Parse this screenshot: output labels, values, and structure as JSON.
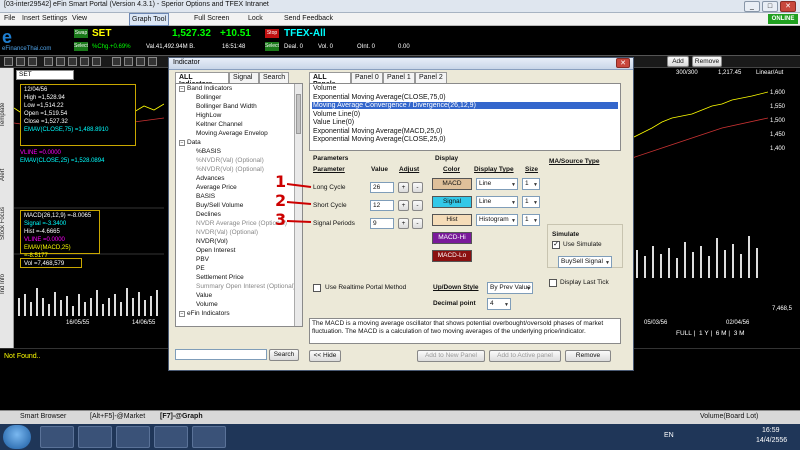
{
  "window": {
    "title": "[03-inter29542] eFin Smart Portal (Version 4.3.1) - Sperior Options and TFEX Intranet",
    "status": "ONLINE"
  },
  "menu": {
    "file": "File",
    "insert": "Insert",
    "settings": "Settings",
    "view": "View",
    "graph_tool": "Graph Tool",
    "full_screen": "Full Screen",
    "lock": "Lock",
    "send_feedback": "Send Feedback"
  },
  "ticker": {
    "logo": "eFinanceThai.com",
    "set_tag": "Swap",
    "set_name": "SET",
    "set_value": "1,527.32",
    "set_change": "+10.51",
    "select_tag": "Select",
    "chg": "%Chg.+0.69%",
    "val": "Val.41,492.94M B.",
    "time": "16:51:48",
    "stop_tag": "Stop",
    "tfex_name": "TFEX-All",
    "tfex_select": "Select",
    "deal": "Deal. 0",
    "vol": "Vol. 0",
    "oint": "OInt. 0",
    "ind": "0.00"
  },
  "chart": {
    "symbol": "SET",
    "add": "Add",
    "remove": "Remove",
    "info": {
      "date": "12/04/56",
      "high": "High =1,528.94",
      "low": "Low =1,514.22",
      "open": "Open =1,519.54",
      "close": "Close =1,527.32",
      "emav_close75": "EMAV(CLOSE,75) =1,488.8910",
      "vline": "VLINE =0.0000",
      "emav_close25": "EMAV(CLOSE,25) =1,528.0894"
    },
    "macd": {
      "title": "MACD(26,12,9) =-8.0065",
      "signal": "Signal =-3.3400",
      "hist": "Hist =-4.6665",
      "vline": "VLINE =0.0000",
      "emav": "EMAV(MACD,25) =-8.5177"
    },
    "vol": "Vol =7,468,579",
    "dates": [
      "16/05/55",
      "14/06/55",
      "05/03/56",
      "02/04/56"
    ],
    "right_top": "300/300",
    "right_val": "1,217.45",
    "right_scale": "Linear/Aut",
    "right_prices": [
      "1,600",
      "1,550",
      "1,500",
      "1,450",
      "1,400"
    ],
    "periods": [
      "FULL",
      "1 Y",
      "6 M",
      "3 M"
    ],
    "right_vol": "7,468,5"
  },
  "rail": {
    "template": "Template",
    "alert": "Alert",
    "stock_focus": "Stock Focus",
    "ind_info": "Ind Info"
  },
  "notfound": "Not Found..",
  "status": {
    "smart_browser": "Smart Browser",
    "market": "[Alt+F5]-@Market",
    "graph": "[F7]-@Graph",
    "volume": "Volume(Board Lot)"
  },
  "taskbar": {
    "lang": "EN",
    "time": "16:59",
    "date": "14/4/2556"
  },
  "dialog": {
    "title": "Indicator",
    "left_tabs": [
      "ALL Indicators",
      "Signal",
      "Search"
    ],
    "tree": [
      {
        "label": "Band Indicators",
        "group": true,
        "dim": false
      },
      {
        "label": "Bollinger",
        "group": false,
        "dim": false
      },
      {
        "label": "Bollinger Band Width",
        "group": false,
        "dim": false
      },
      {
        "label": "HighLow",
        "group": false,
        "dim": false
      },
      {
        "label": "Keltner Channel",
        "group": false,
        "dim": false
      },
      {
        "label": "Moving Average Envelop",
        "group": false,
        "dim": false
      },
      {
        "label": "Data",
        "group": true,
        "dim": false
      },
      {
        "label": "%BASIS",
        "group": false,
        "dim": false
      },
      {
        "label": "%NVDR(Val) (Optional)",
        "group": false,
        "dim": true
      },
      {
        "label": "%NVDR(Vol) (Optional)",
        "group": false,
        "dim": true
      },
      {
        "label": "Advances",
        "group": false,
        "dim": false
      },
      {
        "label": "Average Price",
        "group": false,
        "dim": false
      },
      {
        "label": "BASIS",
        "group": false,
        "dim": false
      },
      {
        "label": "Buy/Sell Volume",
        "group": false,
        "dim": false
      },
      {
        "label": "Declines",
        "group": false,
        "dim": false
      },
      {
        "label": "NVDR Average Price (Optional)",
        "group": false,
        "dim": true
      },
      {
        "label": "NVDR(Val) (Optional)",
        "group": false,
        "dim": true
      },
      {
        "label": "NVDR(Vol)",
        "group": false,
        "dim": false
      },
      {
        "label": "Open Interest",
        "group": false,
        "dim": false
      },
      {
        "label": "PBV",
        "group": false,
        "dim": false
      },
      {
        "label": "PE",
        "group": false,
        "dim": false
      },
      {
        "label": "Settlement Price",
        "group": false,
        "dim": false
      },
      {
        "label": "Summary Open Interest (Optional)",
        "group": false,
        "dim": true
      },
      {
        "label": "Value",
        "group": false,
        "dim": false
      },
      {
        "label": "Volume",
        "group": false,
        "dim": false
      },
      {
        "label": "eFin Indicators",
        "group": true,
        "dim": false
      }
    ],
    "search_button": "Search",
    "hide_button": "<< Hide",
    "right_tabs": [
      "ALL Panels",
      "Panel 0",
      "Panel 1",
      "Panel 2"
    ],
    "panel_list": [
      "Volume",
      "Exponential Moving Average(CLOSE,75,0)",
      "Moving Average Convergence / Divergence(26,12,9)",
      "Volume Line(0)",
      "Value Line(0)",
      "Exponential Moving Average(MACD,25,0)",
      "Exponential Moving Average(CLOSE,25,0)"
    ],
    "selected_index": 2,
    "params": {
      "header": "Parameters",
      "col_param": "Parameter",
      "col_value": "Value",
      "col_adjust": "Adjust",
      "rows": [
        {
          "num": "1",
          "label": "Long Cycle",
          "value": "26"
        },
        {
          "num": "2",
          "label": "Short Cycle",
          "value": "12"
        },
        {
          "num": "3",
          "label": "Signal Periods",
          "value": "9"
        }
      ],
      "plus": "+",
      "minus": "-"
    },
    "display": {
      "header": "Display",
      "col_color": "Color",
      "col_type": "Display Type",
      "col_size": "Size",
      "rows": [
        {
          "name": "MACD",
          "color": "#dfc09a",
          "type": "Line",
          "size": "1"
        },
        {
          "name": "Signal",
          "color": "#33c8e8",
          "type": "Line",
          "size": "1"
        },
        {
          "name": "Hist",
          "color": "#f5dcb8",
          "type": "Histogram",
          "size": "1"
        }
      ],
      "extra1": {
        "label": "MACD-Hi",
        "color": "#7a1a9a"
      },
      "extra2": {
        "label": "MACD-Lo",
        "color": "#8a1010"
      },
      "updown_label": "Up/Down Style",
      "updown_value": "By Prev Value",
      "decimal_label": "Decimal point",
      "decimal_value": "4"
    },
    "ma": {
      "header": "MA/Source Type"
    },
    "simulate": {
      "header": "Simulate",
      "use_label": "Use Simulate",
      "use_checked": true,
      "mode": "BuySell Signal",
      "last_tick_label": "Display Last Tick",
      "last_tick_checked": false
    },
    "realtime_label": "Use Realtime Portal Method",
    "description": "The MACD is a moving average oscillator that shows potential overbought/oversold phases of market fluctuation. The MACD is a calculation of two moving averages of the underlying price/indicator.",
    "add_new_panel": "Add to New Panel",
    "add_active_panel": "Add to Active panel",
    "remove_button": "Remove"
  }
}
